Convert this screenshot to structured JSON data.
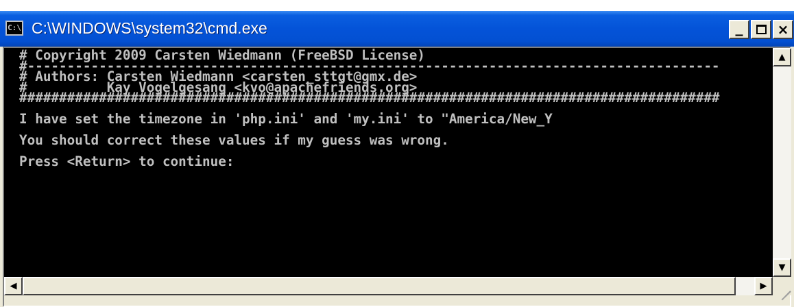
{
  "window": {
    "title": "C:\\WINDOWS\\system32\\cmd.exe",
    "icon_label": "C:\\",
    "icon": "console-icon"
  },
  "controls": {
    "minimize": "_",
    "maximize_icon": "maximize-icon",
    "close": "×"
  },
  "console": {
    "foreground": "#c0c0c0",
    "background": "#000000",
    "lines": [
      "# Copyright 2009 Carsten Wiedmann (FreeBSD License)",
      "#---------------------------------------------------------------------------------------",
      "# Authors: Carsten Wiedmann <carsten_sttgt@gmx.de>",
      "#          Kay Vogelgesang <kvo@apachefriends.org>",
      "########################################################################################",
      "",
      "I have set the timezone in 'php.ini' and 'my.ini' to \"America/New_Y",
      "",
      "You should correct these values if my guess was wrong.",
      "",
      "Press <Return> to continue:"
    ]
  },
  "scrollbars": {
    "up_arrow": "▲",
    "down_arrow": "▼",
    "left_arrow": "◀",
    "right_arrow": "▶"
  },
  "colors": {
    "titlebar": "#0453d8",
    "frame": "#ece9d8"
  }
}
